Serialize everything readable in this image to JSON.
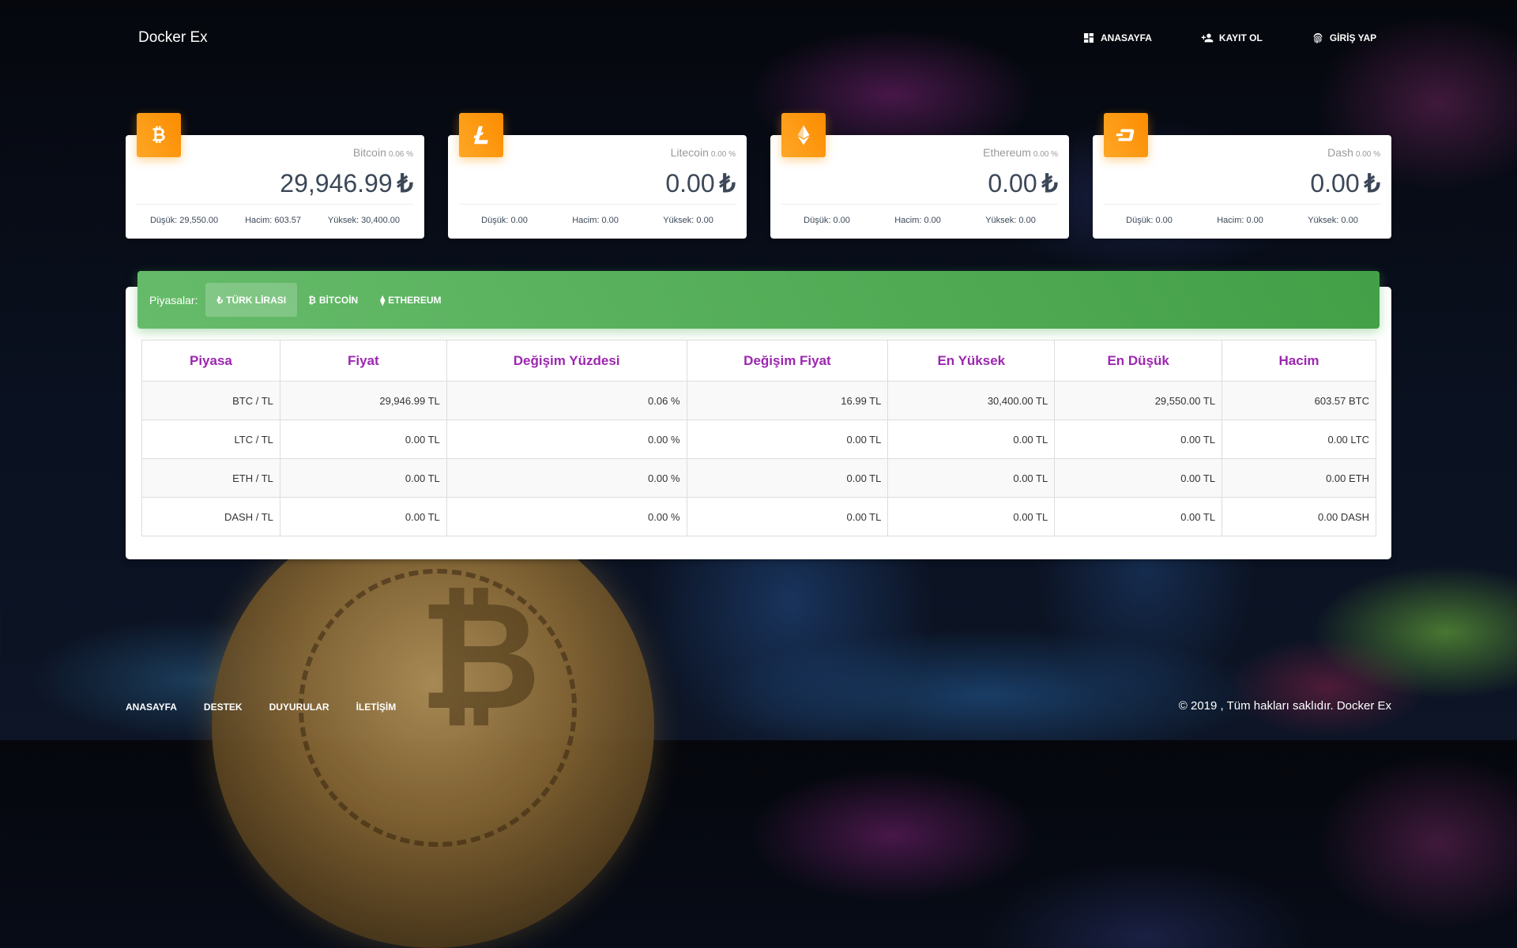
{
  "brand": "Docker Ex",
  "topnav": [
    {
      "label": "ANASAYFA",
      "icon": "dashboard-icon"
    },
    {
      "label": "KAYIT OL",
      "icon": "person-add-icon"
    },
    {
      "label": "GİRİŞ YAP",
      "icon": "fingerprint-icon"
    }
  ],
  "cards": [
    {
      "name": "Bitcoin",
      "pct": "0.06 %",
      "price": "29,946.99",
      "currency": "₺",
      "low": "Düşük: 29,550.00",
      "volume": "Hacim: 603.57",
      "high": "Yüksek: 30,400.00",
      "icon": "bitcoin-icon"
    },
    {
      "name": "Litecoin",
      "pct": "0.00 %",
      "price": "0.00",
      "currency": "₺",
      "low": "Düşük: 0.00",
      "volume": "Hacim: 0.00",
      "high": "Yüksek: 0.00",
      "icon": "litecoin-icon"
    },
    {
      "name": "Ethereum",
      "pct": "0.00 %",
      "price": "0.00",
      "currency": "₺",
      "low": "Düşük: 0.00",
      "volume": "Hacim: 0.00",
      "high": "Yüksek: 0.00",
      "icon": "ethereum-icon"
    },
    {
      "name": "Dash",
      "pct": "0.00 %",
      "price": "0.00",
      "currency": "₺",
      "low": "Düşük: 0.00",
      "volume": "Hacim: 0.00",
      "high": "Yüksek: 0.00",
      "icon": "dash-icon"
    }
  ],
  "markets": {
    "label": "Piyasalar:",
    "tabs": [
      {
        "label": "TÜRK LİRASI",
        "symbol": "₺",
        "active": true
      },
      {
        "label": "BİTCOİN",
        "symbol": "₿",
        "active": false
      },
      {
        "label": "ETHEREUM",
        "symbol": "⧫",
        "active": false
      }
    ]
  },
  "table": {
    "headers": [
      "Piyasa",
      "Fiyat",
      "Değişim Yüzdesi",
      "Değişim Fiyat",
      "En Yüksek",
      "En Düşük",
      "Hacim"
    ],
    "rows": [
      [
        "BTC / TL",
        "29,946.99 TL",
        "0.06 %",
        "16.99 TL",
        "30,400.00 TL",
        "29,550.00 TL",
        "603.57 BTC"
      ],
      [
        "LTC / TL",
        "0.00 TL",
        "0.00 %",
        "0.00 TL",
        "0.00 TL",
        "0.00 TL",
        "0.00 LTC"
      ],
      [
        "ETH / TL",
        "0.00 TL",
        "0.00 %",
        "0.00 TL",
        "0.00 TL",
        "0.00 TL",
        "0.00 ETH"
      ],
      [
        "DASH / TL",
        "0.00 TL",
        "0.00 %",
        "0.00 TL",
        "0.00 TL",
        "0.00 TL",
        "0.00 DASH"
      ]
    ]
  },
  "footer": {
    "links": [
      "ANASAYFA",
      "DESTEK",
      "DUYURULAR",
      "İLETİŞİM"
    ],
    "copyright": "© 2019 , Tüm hakları saklıdır. Docker Ex"
  },
  "colors": {
    "badge": "#fb8c00",
    "panel_header": "#4caf50",
    "table_header_text": "#9c27b0"
  }
}
